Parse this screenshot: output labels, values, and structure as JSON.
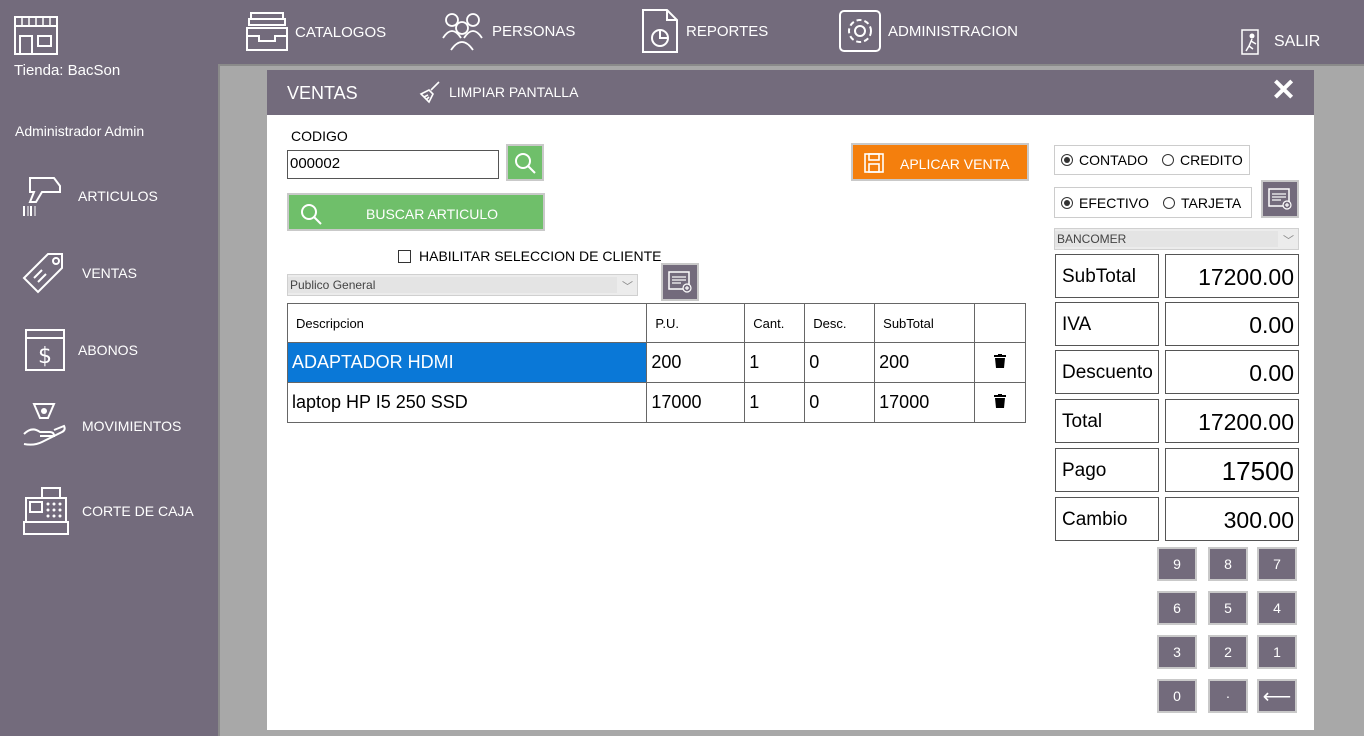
{
  "topnav": {
    "items": [
      {
        "label": "CATALOGOS",
        "icon": "tray-icon"
      },
      {
        "label": "PERSONAS",
        "icon": "people-icon"
      },
      {
        "label": "REPORTES",
        "icon": "report-icon"
      },
      {
        "label": "ADMINISTRACION",
        "icon": "gear-icon"
      }
    ],
    "exit_label": "SALIR"
  },
  "sidebar": {
    "store": "Tienda: BacSon",
    "user": "Administrador Admin",
    "items": [
      {
        "label": "ARTICULOS",
        "icon": "barcode-scanner-icon"
      },
      {
        "label": "VENTAS",
        "icon": "price-tag-icon"
      },
      {
        "label": "ABONOS",
        "icon": "dollar-window-icon"
      },
      {
        "label": "MOVIMIENTOS",
        "icon": "hand-money-icon"
      },
      {
        "label": "CORTE DE CAJA",
        "icon": "cash-register-icon"
      }
    ]
  },
  "panel": {
    "title": "VENTAS",
    "clear_label": "LIMPIAR PANTALLA",
    "codigo_label": "CODIGO",
    "codigo_value": "000002",
    "buscar_label": "BUSCAR ARTICULO",
    "aplicar_label": "APLICAR VENTA",
    "habilitar_label": "HABILITAR SELECCION DE CLIENTE",
    "cliente_value": "Publico General",
    "table": {
      "headers": [
        "Descripcion",
        "P.U.",
        "Cant.",
        "Desc.",
        "SubTotal",
        ""
      ],
      "rows": [
        {
          "desc": "ADAPTADOR HDMI",
          "pu": "200",
          "cant": "1",
          "descuento": "0",
          "subtotal": "200"
        },
        {
          "desc": "laptop HP I5 250 SSD",
          "pu": "17000",
          "cant": "1",
          "descuento": "0",
          "subtotal": "17000"
        }
      ]
    }
  },
  "payment": {
    "contado": "CONTADO",
    "credito": "CREDITO",
    "efectivo": "EFECTIVO",
    "tarjeta": "TARJETA",
    "bank": "BANCOMER",
    "summary": [
      {
        "label": "SubTotal",
        "value": "17200.00"
      },
      {
        "label": "IVA",
        "value": "0.00"
      },
      {
        "label": "Descuento",
        "value": "0.00"
      },
      {
        "label": "Total",
        "value": "17200.00"
      },
      {
        "label": "Pago",
        "value": "17500"
      },
      {
        "label": "Cambio",
        "value": "300.00"
      }
    ],
    "keypad": [
      "9",
      "8",
      "7",
      "6",
      "5",
      "4",
      "3",
      "2",
      "1",
      "0",
      "·",
      "⟵"
    ]
  }
}
